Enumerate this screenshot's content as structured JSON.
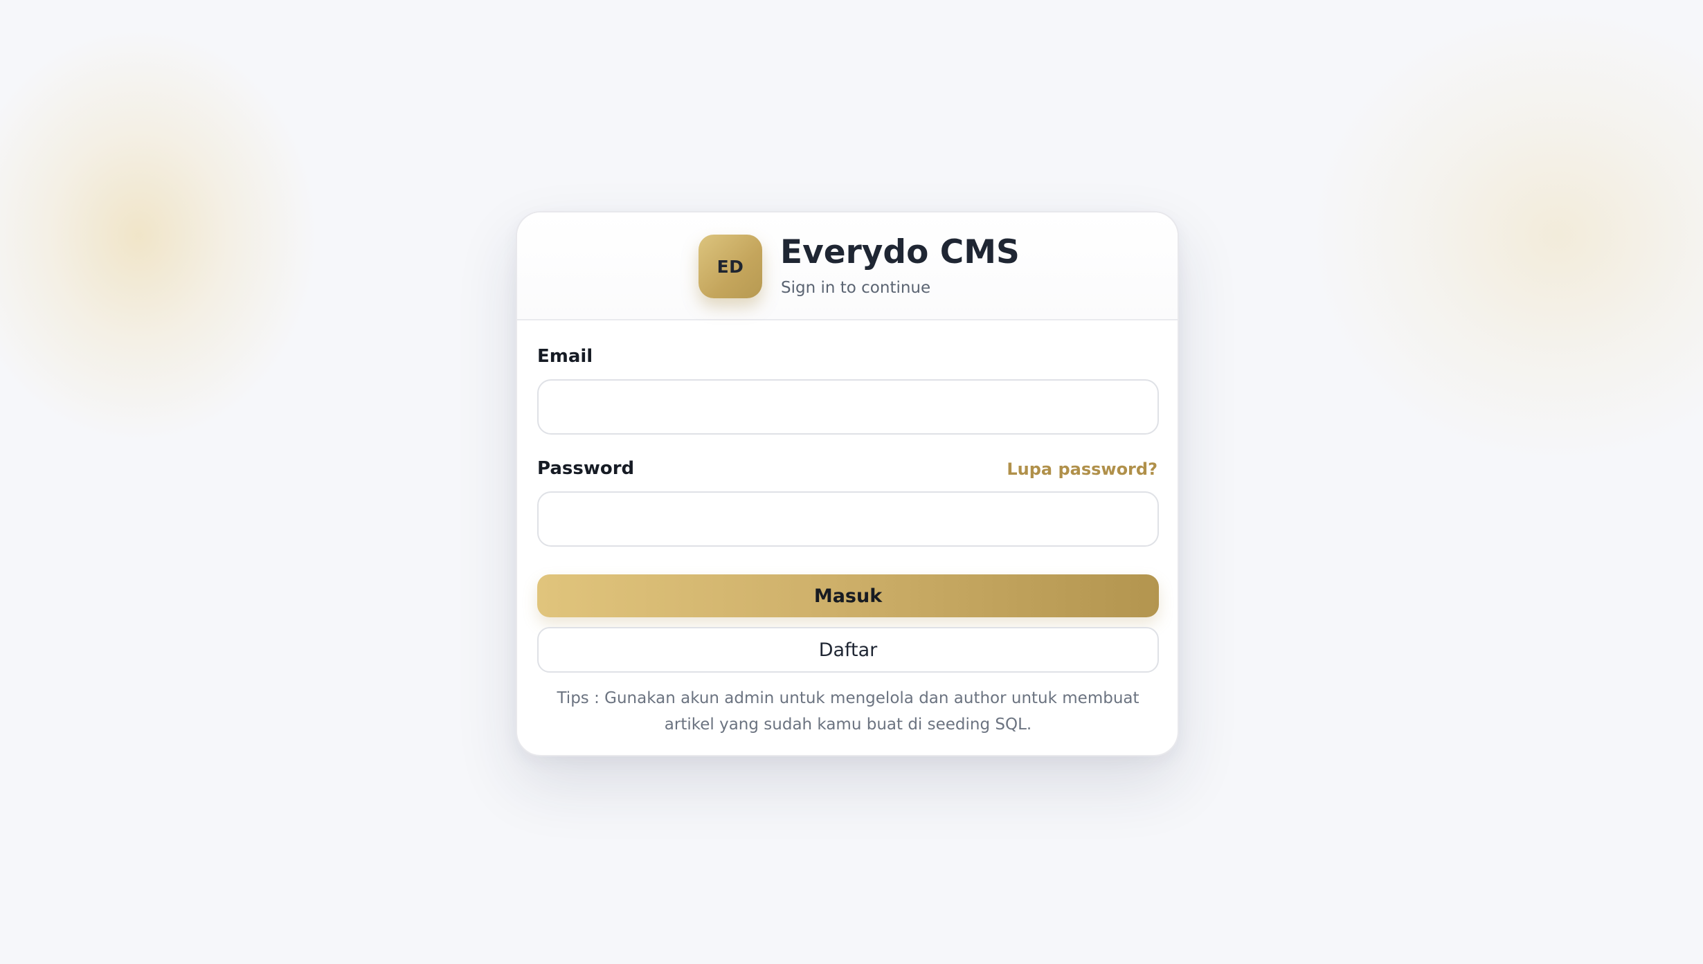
{
  "brand": {
    "logo_initials": "ED",
    "title": "Everydo CMS",
    "subtitle": "Sign in to continue"
  },
  "form": {
    "email_label": "Email",
    "email_value": "",
    "email_placeholder": "",
    "password_label": "Password",
    "password_value": "",
    "password_placeholder": "",
    "forgot_password_label": "Lupa password?",
    "submit_label": "Masuk",
    "register_label": "Daftar",
    "tips": "Tips : Gunakan akun admin untuk mengelola dan author untuk membuat artikel yang sudah kamu buat di seeding SQL."
  },
  "colors": {
    "accent": "#c4a55c",
    "accent_light": "#e0c47c",
    "link": "#b0904a",
    "background": "#f6f7fa"
  },
  "icons": {
    "logo": "logo-badge-icon"
  }
}
